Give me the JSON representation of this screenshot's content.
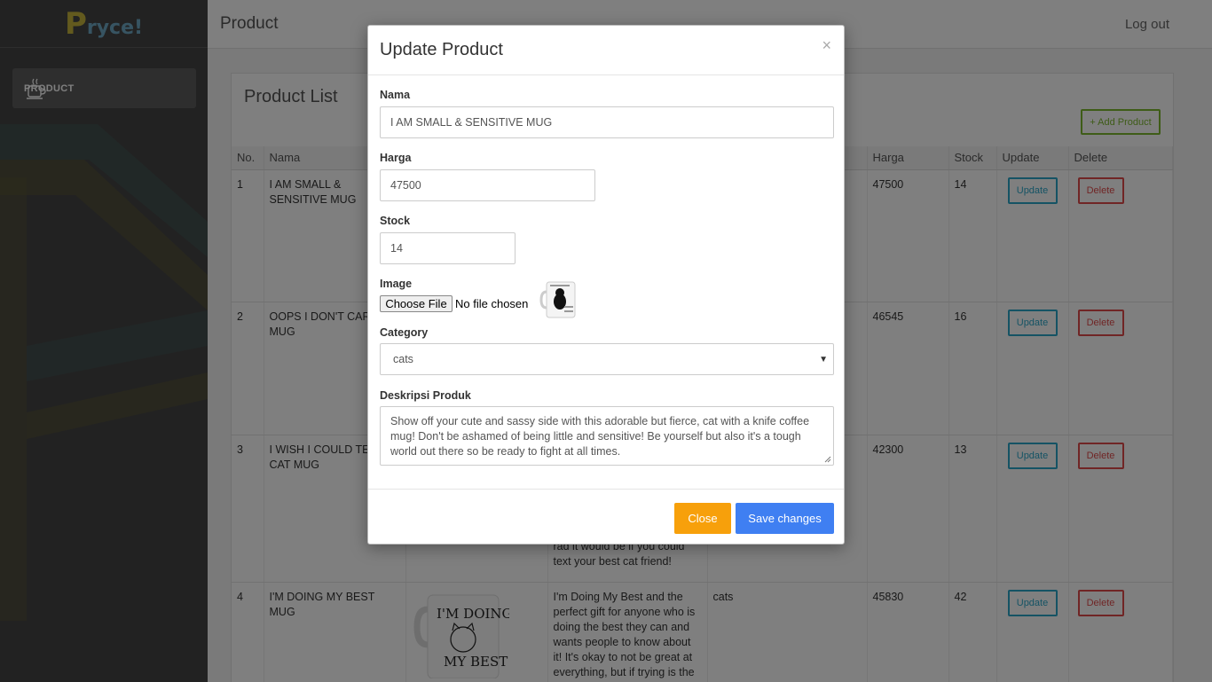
{
  "brand": {
    "logo_p": "P",
    "logo_rest": "ryce!"
  },
  "sidebar": {
    "items": [
      {
        "label": "PRODUCT",
        "icon": "coffee-cup-icon"
      }
    ]
  },
  "topbar": {
    "title": "Product",
    "logout": "Log out"
  },
  "panel": {
    "title": "Product List",
    "add_label": "+ Add Product",
    "columns": [
      "No.",
      "Nama",
      "Harga",
      "Stock",
      "Update",
      "Delete"
    ],
    "rows": [
      {
        "no": "1",
        "nama": "I AM SMALL & SENSITIVE MUG",
        "category": "",
        "desc": "",
        "harga": "47500",
        "stock": "14"
      },
      {
        "no": "2",
        "nama": "OOPS I DON'T CARE MUG",
        "category": "",
        "desc": "",
        "harga": "46545",
        "stock": "16"
      },
      {
        "no": "3",
        "nama": "I WISH I COULD TEXT CAT MUG",
        "category": "",
        "desc": "rad it would be if you could text your best cat friend!",
        "harga": "42300",
        "stock": "13"
      },
      {
        "no": "4",
        "nama": "I'M DOING MY BEST MUG",
        "category": "cats",
        "desc": "I'm Doing My Best and the perfect gift for anyone who is doing the best they can and wants people to know about it! It's okay to not be great at everything, but if trying is the",
        "harga": "45830",
        "stock": "42"
      }
    ],
    "update_label": "Update",
    "delete_label": "Delete"
  },
  "modal": {
    "title": "Update Product",
    "close_x": "×",
    "nama_label": "Nama",
    "nama_value": "I AM SMALL & SENSITIVE MUG",
    "harga_label": "Harga",
    "harga_value": "47500",
    "stock_label": "Stock",
    "stock_value": "14",
    "image_label": "Image",
    "file_button": "Choose File",
    "file_status": "No file chosen",
    "category_label": "Category",
    "category_value": "cats",
    "category_arrow": "▼",
    "desc_label": "Deskripsi Produk",
    "desc_value": "Show off your cute and sassy side with this adorable but fierce, cat with a knife coffee mug! Don't be ashamed of being little and sensitive! Be yourself but also it's a tough world out there so be ready to fight at all times.",
    "close_button": "Close",
    "save_button": "Save changes"
  }
}
